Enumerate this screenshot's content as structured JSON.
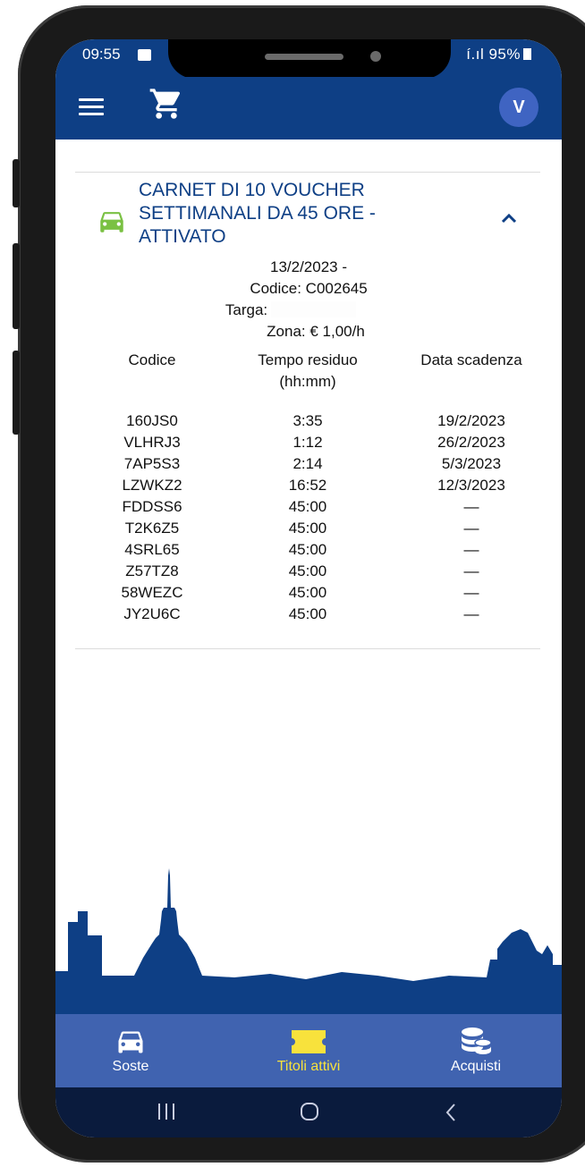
{
  "status_bar": {
    "time": "09:55",
    "right": "í.ıl 95%"
  },
  "app_bar": {
    "menu_icon": "hamburger-menu-icon",
    "cart_icon": "shopping-cart-icon",
    "avatar_initial": "V"
  },
  "card": {
    "icon": "car-icon",
    "title_lines": [
      "CARNET DI 10 VOUCHER",
      "SETTIMANALI DA 45 ORE -",
      "ATTIVATO"
    ],
    "date": "13/2/2023 -",
    "codice": "Codice: C002645",
    "targa": "Targa:",
    "zona": "Zona: € 1,00/h",
    "columns": {
      "codice": "Codice",
      "tempo_line1": "Tempo residuo",
      "tempo_line2": "(hh:mm)",
      "scadenza": "Data scadenza"
    },
    "rows": [
      {
        "code": "160JS0",
        "time": "3:35",
        "expiry": "19/2/2023"
      },
      {
        "code": "VLHRJ3",
        "time": "1:12",
        "expiry": "26/2/2023"
      },
      {
        "code": "7AP5S3",
        "time": "2:14",
        "expiry": "5/3/2023"
      },
      {
        "code": "LZWKZ2",
        "time": "16:52",
        "expiry": "12/3/2023"
      },
      {
        "code": "FDDSS6",
        "time": "45:00",
        "expiry": "—"
      },
      {
        "code": "T2K6Z5",
        "time": "45:00",
        "expiry": "—"
      },
      {
        "code": "4SRL65",
        "time": "45:00",
        "expiry": "—"
      },
      {
        "code": "Z57TZ8",
        "time": "45:00",
        "expiry": "—"
      },
      {
        "code": "58WEZC",
        "time": "45:00",
        "expiry": "—"
      },
      {
        "code": "JY2U6C",
        "time": "45:00",
        "expiry": "—"
      }
    ]
  },
  "bottom_nav": {
    "items": [
      {
        "label": "Soste",
        "icon": "car-icon"
      },
      {
        "label": "Titoli attivi",
        "icon": "ticket-icon",
        "active": true
      },
      {
        "label": "Acquisti",
        "icon": "coins-icon"
      }
    ]
  },
  "colors": {
    "primary": "#0e3f85",
    "nav": "#4063b0",
    "active": "#f8e23c",
    "car_green": "#7ac143"
  }
}
